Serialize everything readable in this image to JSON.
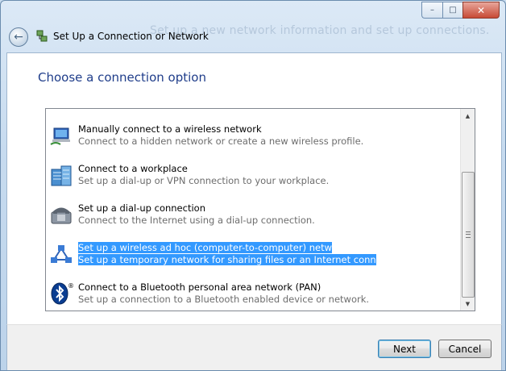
{
  "window": {
    "title": "Set Up a Connection or Network",
    "background_text": "Set up a new network information and set up connections.",
    "controls": {
      "minimize": "–",
      "maximize": "□",
      "close": "✕"
    }
  },
  "main": {
    "heading": "Choose a connection option",
    "options": [
      {
        "title": "Manually connect to a wireless network",
        "description": "Connect to a hidden network or create a new wireless profile.",
        "icon": "wireless-network-icon",
        "selected": false
      },
      {
        "title": "Connect to a workplace",
        "description": "Set up a dial-up or VPN connection to your workplace.",
        "icon": "workplace-building-icon",
        "selected": false
      },
      {
        "title": "Set up a dial-up connection",
        "description": "Connect to the Internet using a dial-up connection.",
        "icon": "telephone-modem-icon",
        "selected": false
      },
      {
        "title": "Set up a wireless ad hoc (computer-to-computer) network",
        "description": "Set up a temporary network for sharing files or an Internet connection.",
        "icon": "ad-hoc-network-icon",
        "selected": true
      },
      {
        "title": "Connect to a Bluetooth personal area network (PAN)",
        "description": "Set up a connection to a Bluetooth enabled device or network.",
        "icon": "bluetooth-icon",
        "selected": false
      }
    ]
  },
  "footer": {
    "next_label": "Next",
    "cancel_label": "Cancel"
  },
  "colors": {
    "selection": "#3399ff",
    "heading": "#1f3d8a",
    "chrome": "#c7dbef"
  }
}
